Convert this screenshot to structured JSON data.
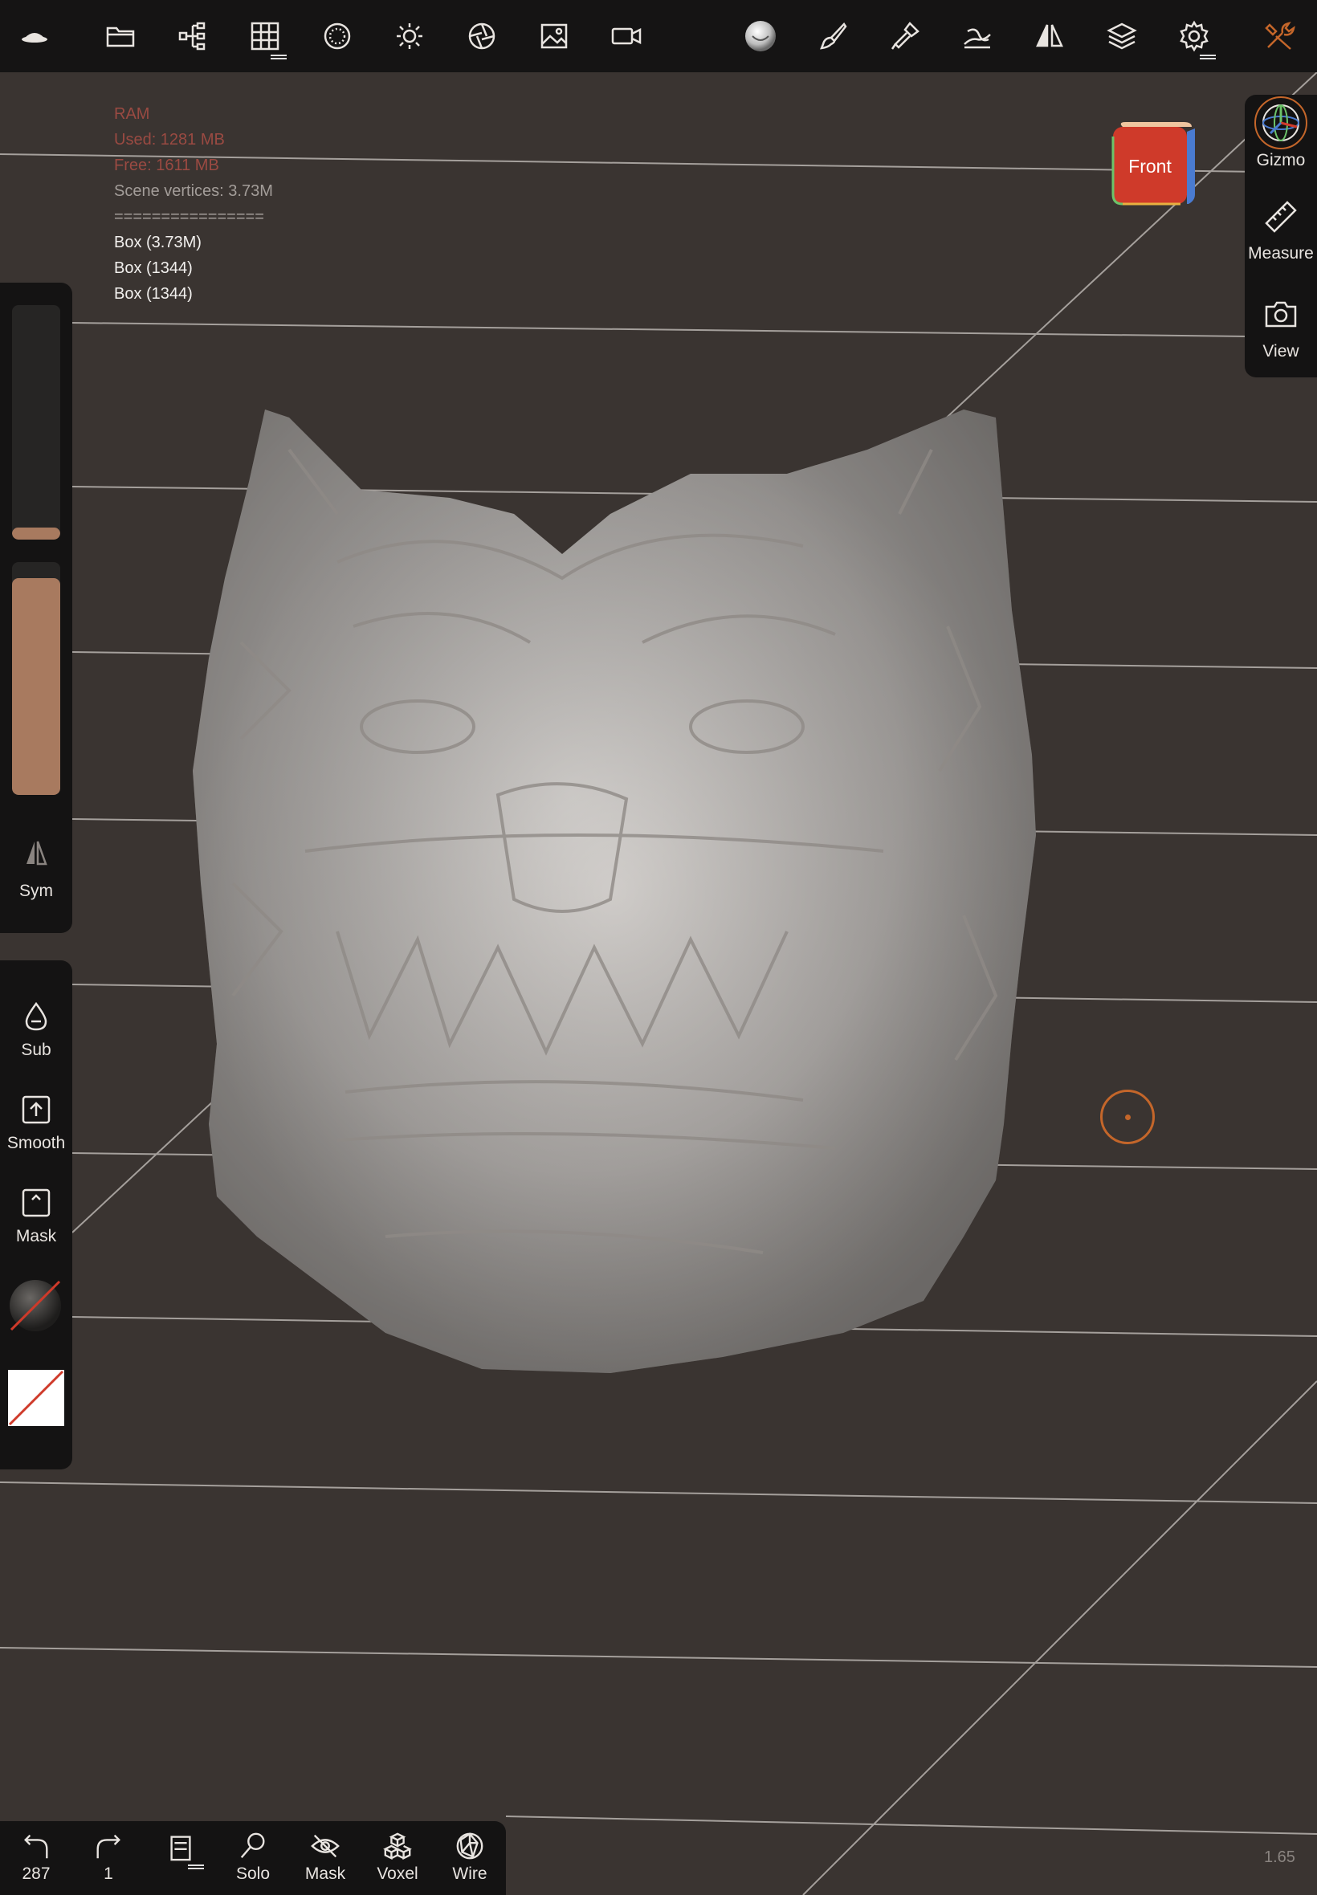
{
  "colors": {
    "background": "#3a3431",
    "toolbar": "#151414",
    "panel": "#141313",
    "accent_orange": "#c4662a",
    "slider_fill": "#a87a5f",
    "stats_red": "#9a4a42"
  },
  "toolbar": {
    "icons": [
      "logo-icon",
      "folder-icon",
      "scene-tree-icon",
      "topology-grid-icon",
      "material-sphere-icon",
      "light-sun-icon",
      "camera-shutter-icon",
      "image-icon",
      "video-camera-icon",
      "matcap-sphere-icon",
      "brush-icon",
      "paint-icon",
      "select-tool-icon",
      "symmetry-icon",
      "layers-icon",
      "settings-gear-icon",
      "tools-icon"
    ]
  },
  "stats": {
    "ram_label": "RAM",
    "used": "Used: 1281 MB",
    "free": "Free: 1611 MB",
    "scene_vertices": "Scene vertices: 3.73M",
    "separator": "================",
    "objects": [
      "Box (3.73M)",
      "Box (1344)",
      "Box (1344)"
    ]
  },
  "nav_cube": {
    "face": "Front"
  },
  "right_panel": {
    "gizmo": "Gizmo",
    "measure": "Measure",
    "view": "View"
  },
  "left_panel": {
    "sym": "Sym",
    "sub": "Sub",
    "smooth": "Smooth",
    "mask": "Mask",
    "radius_level": 0.05,
    "intensity_level": 0.93
  },
  "bottom_bar": {
    "undo_count": "287",
    "redo_count": "1",
    "solo": "Solo",
    "mask": "Mask",
    "voxel": "Voxel",
    "wire": "Wire"
  },
  "version": "1.65"
}
